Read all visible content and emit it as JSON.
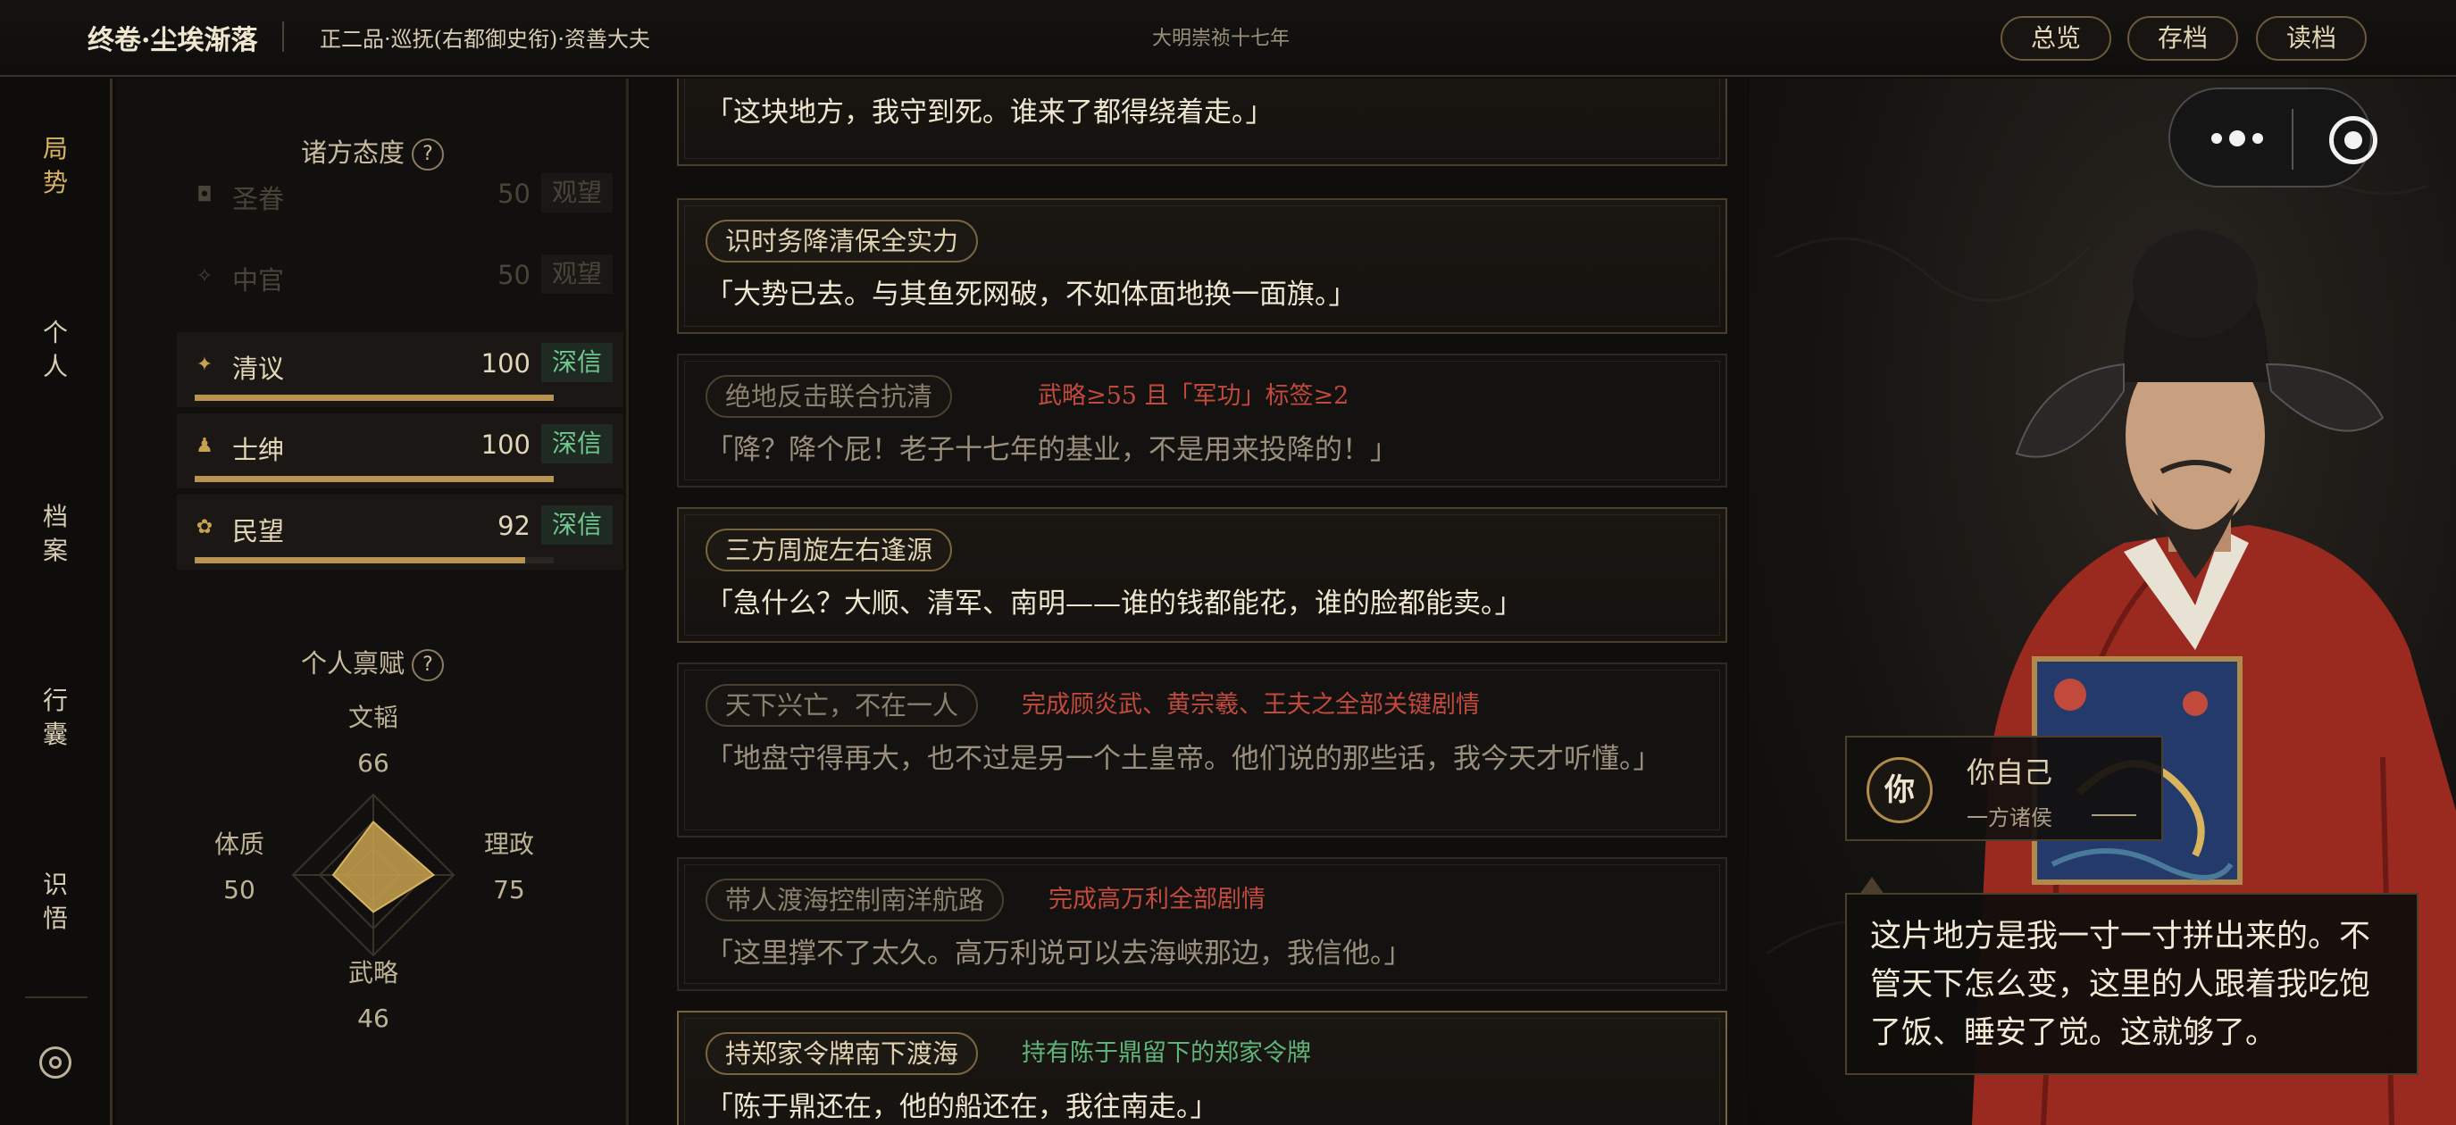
{
  "topbar": {
    "title": "终卷·尘埃渐落",
    "rank": "正二品·巡抚(右都御史衔)·资善大夫",
    "era": "大明崇祯十七年",
    "buttons": {
      "overview": "总览",
      "save": "存档",
      "load": "读档"
    }
  },
  "nav": {
    "items": [
      {
        "label": "局\n势",
        "active": true
      },
      {
        "label": "个\n人",
        "active": false
      },
      {
        "label": "档\n案",
        "active": false
      },
      {
        "label": "行\n囊",
        "active": false
      },
      {
        "label": "识\n悟",
        "active": false
      }
    ],
    "settings_icon": "settings-icon"
  },
  "factions": {
    "heading": "诸方态度",
    "help": "?",
    "rows": [
      {
        "icon": "imperial-seal-icon",
        "glyph": "◘",
        "name": "圣眷",
        "value": "50",
        "tag": "观望",
        "faded": true
      },
      {
        "icon": "eunuch-icon",
        "glyph": "✧",
        "name": "中官",
        "value": "50",
        "tag": "观望",
        "faded": true
      },
      {
        "icon": "scholar-icon",
        "glyph": "✦",
        "name": "清议",
        "value": "100",
        "tag": "深信",
        "level": 1.0
      },
      {
        "icon": "gentry-icon",
        "glyph": "♟",
        "name": "士绅",
        "value": "100",
        "tag": "深信",
        "level": 1.0
      },
      {
        "icon": "people-icon",
        "glyph": "✿",
        "name": "民望",
        "value": "92",
        "tag": "深信",
        "level": 0.92
      }
    ]
  },
  "talents": {
    "heading": "个人禀赋",
    "help": "?",
    "stats": {
      "wen": {
        "label": "文韬",
        "value": "66"
      },
      "li": {
        "label": "理政",
        "value": "75"
      },
      "wu": {
        "label": "武略",
        "value": "46"
      },
      "ti": {
        "label": "体质",
        "value": "50"
      }
    }
  },
  "cards": [
    {
      "title": "",
      "cond": "",
      "cond_color": "",
      "quote": "「这块地方，我守到死。谁来了都得绕着走。」",
      "dim": false
    },
    {
      "title": "识时务降清保全实力",
      "cond": "",
      "cond_color": "",
      "quote": "「大势已去。与其鱼死网破，不如体面地换一面旗。」",
      "dim": false
    },
    {
      "title": "绝地反击联合抗清",
      "cond": "武略≥55 且「军功」标签≥2",
      "cond_color": "red",
      "quote": "「降？降个屁！老子十七年的基业，不是用来投降的！」",
      "dim": true
    },
    {
      "title": "三方周旋左右逢源",
      "cond": "",
      "cond_color": "",
      "quote": "「急什么？大顺、清军、南明——谁的钱都能花，谁的脸都能卖。」",
      "dim": false
    },
    {
      "title": "天下兴亡，不在一人",
      "cond": "完成顾炎武、黄宗羲、王夫之全部关键剧情",
      "cond_color": "red",
      "quote": "「地盘守得再大，也不过是另一个土皇帝。他们说的那些话，我今天才听懂。」",
      "dim": true
    },
    {
      "title": "带人渡海控制南洋航路",
      "cond": "完成高万利全部剧情",
      "cond_color": "red",
      "quote": "「这里撑不了太久。高万利说可以去海峡那边，我信他。」",
      "dim": true
    },
    {
      "title": "持郑家令牌南下渡海",
      "cond": "持有陈于鼎留下的郑家令牌",
      "cond_color": "green",
      "quote": "「陈于鼎还在，他的船还在，我往南走。」",
      "dim": false
    }
  ],
  "character": {
    "badge": "你",
    "name": "你自己",
    "title": "一方诸侯",
    "speech": "这片地方是我一寸一寸拼出来的。不管天下怎么变，这里的人跟着我吃饱了饭、睡安了觉。这就够了。"
  },
  "colors": {
    "accent": "#d9b45f",
    "trust": "#6fc88e",
    "locked": "#c24a3c",
    "unlocked": "#5fb47a"
  }
}
